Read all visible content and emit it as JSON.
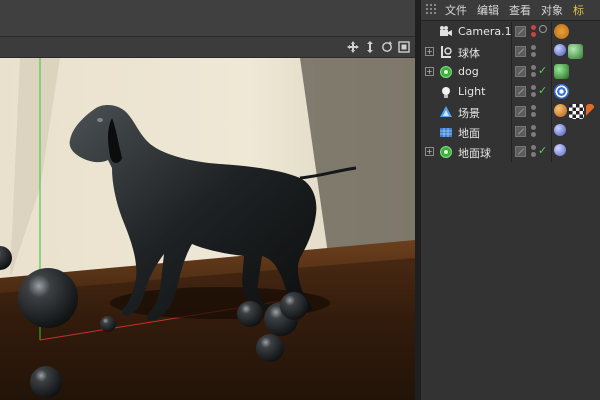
{
  "menu": {
    "items": [
      "文件",
      "编辑",
      "查看",
      "对象",
      "标"
    ]
  },
  "objects": [
    {
      "name": "Camera.1",
      "icon": "camera-icon",
      "has_tree": false,
      "checked": false
    },
    {
      "name": "球体",
      "icon": "null-object-icon",
      "has_tree": true,
      "checked": false
    },
    {
      "name": "dog",
      "icon": "polygon-object-icon",
      "has_tree": true,
      "checked": true
    },
    {
      "name": "Light",
      "icon": "light-icon",
      "has_tree": false,
      "checked": true
    },
    {
      "name": "场景",
      "icon": "scene-icon",
      "has_tree": false,
      "checked": false
    },
    {
      "name": "地面",
      "icon": "floor-icon",
      "has_tree": false,
      "checked": false
    },
    {
      "name": "地面球",
      "icon": "null-object-icon",
      "has_tree": true,
      "checked": true
    }
  ],
  "colors": {
    "accent_menu": "#e0c34a",
    "check_green": "#4fd24f",
    "panel_bg": "#333333"
  }
}
